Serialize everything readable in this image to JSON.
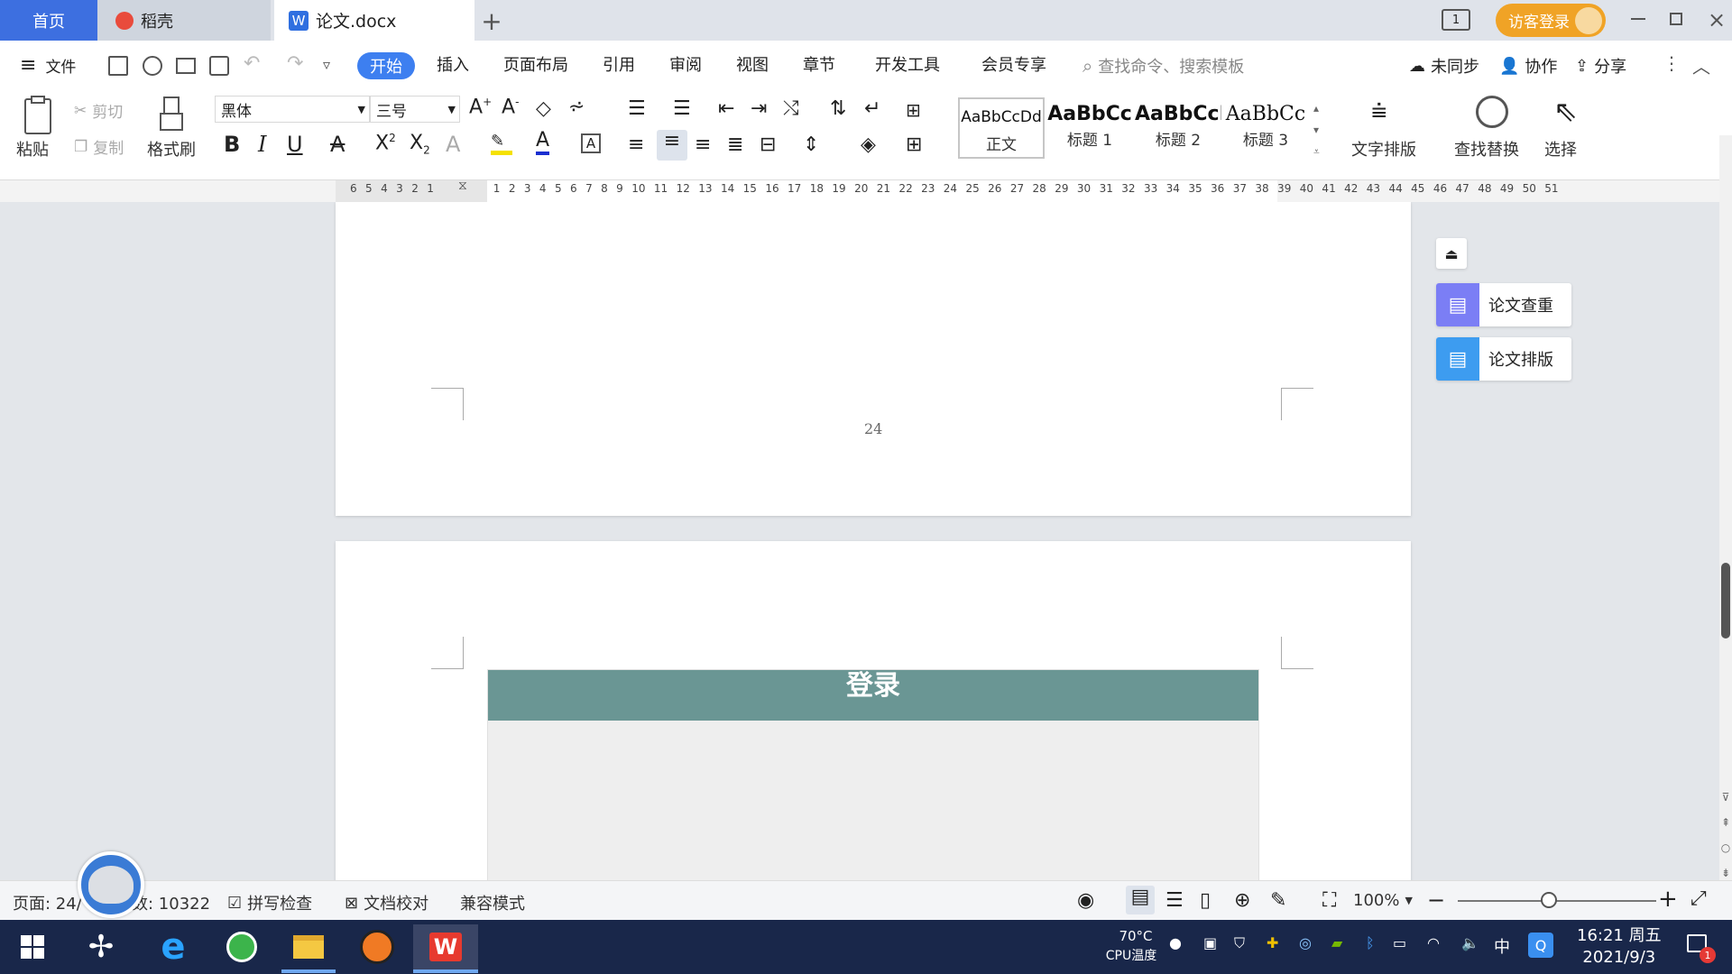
{
  "tabs": {
    "home": "首页",
    "daoke": "稻壳",
    "doc": "论文.docx",
    "add": "+"
  },
  "titlebar": {
    "page_num_icon": "1",
    "login": "访客登录"
  },
  "menu": {
    "file": "文件",
    "items": [
      "开始",
      "插入",
      "页面布局",
      "引用",
      "审阅",
      "视图",
      "章节",
      "开发工具",
      "会员专享"
    ],
    "search_placeholder": "查找命令、搜索模板",
    "unsynced": "未同步",
    "collab": "协作",
    "share": "分享"
  },
  "ribbon": {
    "paste": "粘贴",
    "cut": "剪切",
    "copy": "复制",
    "format_painter": "格式刷",
    "font_name": "黑体",
    "font_size": "三号",
    "styles": [
      {
        "sample": "AaBbCcDd",
        "name": "正文"
      },
      {
        "sample": "AaBbCc",
        "name": "标题 1"
      },
      {
        "sample": "AaBbCcI",
        "name": "标题 2"
      },
      {
        "sample": "AaBbCc",
        "name": "标题 3"
      }
    ],
    "text_layout": "文字排版",
    "find_replace": "查找替换",
    "select": "选择"
  },
  "ruler": {
    "ticks": "6 5 4 3 2 1 &nbsp;&nbsp;&nbsp;&nbsp;&nbsp; 1 2 3 4 5 6 7 8 9 10 11 12 13 14 15 16 17 18 19 20 21 22 23 24 25 26 27 28 29 30 31 32 33 34 35 36 37 38 39 40 41 42 43 44 45 46 47 48 49 50 51"
  },
  "document": {
    "page_number": "24",
    "image_title": "登录"
  },
  "side_panel": {
    "check": "论文查重",
    "layout": "论文排版"
  },
  "status": {
    "page": "页面: 24/",
    "words": "数: 10322",
    "spell": "拼写检查",
    "proof": "文档校对",
    "compat": "兼容模式",
    "zoom": "100%"
  },
  "taskbar": {
    "temp": "70°C",
    "cpu": "CPU温度",
    "ime": "中",
    "time": "16:21 周五",
    "date": "2021/9/3",
    "notify": "1"
  },
  "colors": {
    "accent": "#3d7ff0",
    "login": "#f0a326",
    "image_header": "#6a9694",
    "taskbar": "#19274a"
  }
}
